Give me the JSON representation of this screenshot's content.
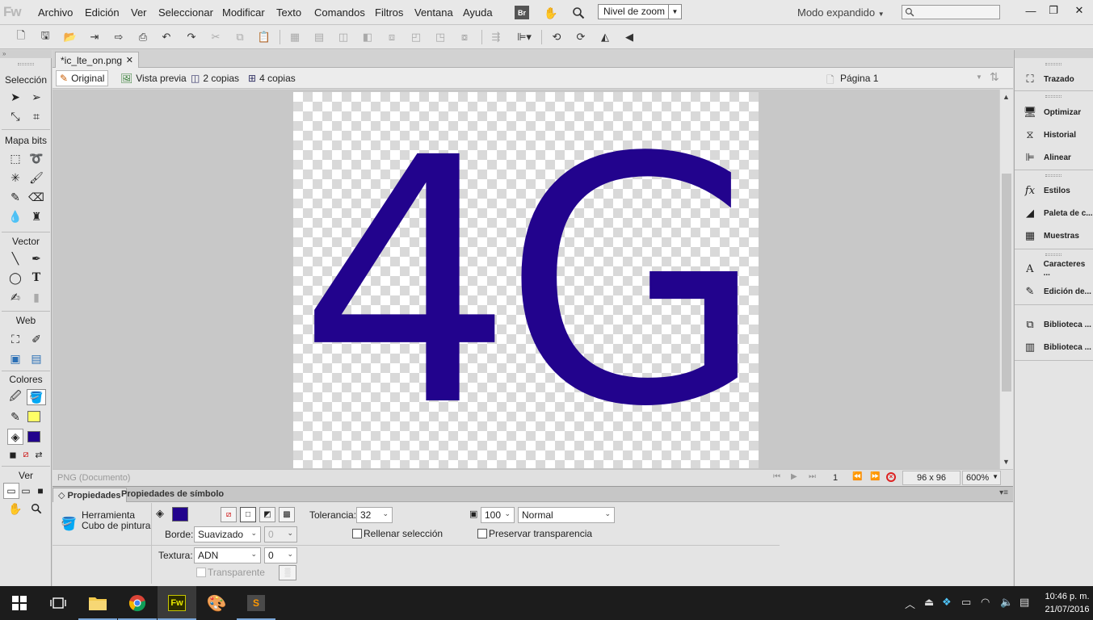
{
  "app": {
    "logo": "Fw",
    "menus": [
      "Archivo",
      "Edición",
      "Ver",
      "Seleccionar",
      "Modificar",
      "Texto",
      "Comandos",
      "Filtros",
      "Ventana",
      "Ayuda"
    ],
    "bridge_label": "Br",
    "zoom_combo": "Nivel de zoom",
    "workspace_mode": "Modo expandido",
    "window_buttons": [
      "minimize-icon",
      "restore-icon",
      "close-icon"
    ]
  },
  "document": {
    "tab_title": "*ic_lte_on.png",
    "views": [
      "Original",
      "Vista previa",
      "2 copias",
      "4 copias"
    ],
    "active_view": "Original",
    "page": "Página 1",
    "artwork_text": "4G",
    "artwork_color": "#22038d"
  },
  "tools": {
    "sections": [
      "Selección",
      "Mapa bits",
      "Vector",
      "Web",
      "Colores",
      "Ver"
    ],
    "stroke_color": "#ffff66",
    "fill_color": "#22038d"
  },
  "status": {
    "doc_type": "PNG (Documento)",
    "page_number": "1",
    "dimensions": "96 x 96",
    "zoom": "600%"
  },
  "properties": {
    "tabs": [
      "Propiedades",
      "Propiedades de símbolo"
    ],
    "tool_name_line1": "Herramienta",
    "tool_name_line2": "Cubo de pintura",
    "fill_color": "#22038d",
    "borde_label": "Borde:",
    "borde_value": "Suavizado",
    "borde_amount": "0",
    "textura_label": "Textura:",
    "textura_value": "ADN",
    "textura_amount": "0",
    "transparente_label": "Transparente",
    "tolerancia_label": "Tolerancia:",
    "tolerancia_value": "32",
    "opacity_value": "100",
    "blend_mode": "Normal",
    "rellenar_label": "Rellenar selección",
    "preservar_label": "Preservar transparencia"
  },
  "right_panel": {
    "items": [
      "Trazado",
      "Optimizar",
      "Historial",
      "Alinear",
      "Estilos",
      "Paleta de c...",
      "Muestras",
      "Caracteres ...",
      "Edición de...",
      "Biblioteca ...",
      "Biblioteca ..."
    ]
  },
  "taskbar": {
    "time": "10:46 p. m.",
    "date": "21/07/2016",
    "fw_label": "Fw",
    "s_label": "S"
  }
}
